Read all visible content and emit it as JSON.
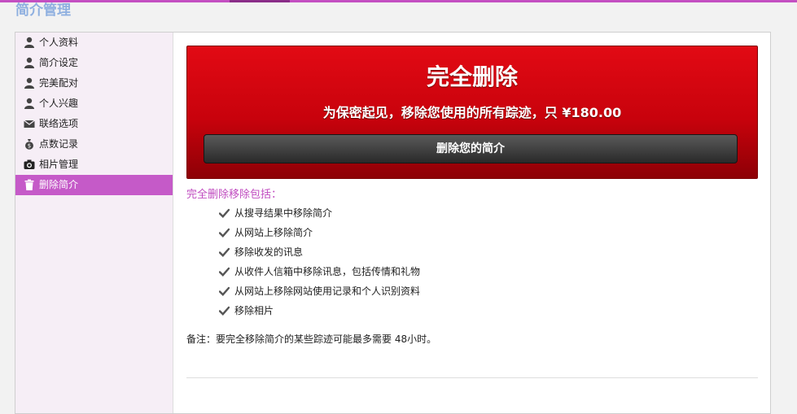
{
  "header": {
    "title": "简介管理"
  },
  "sidebar": {
    "items": [
      {
        "label": "个人资料",
        "icon": "user-icon"
      },
      {
        "label": "简介设定",
        "icon": "user-icon"
      },
      {
        "label": "完美配对",
        "icon": "user-icon"
      },
      {
        "label": "个人兴趣",
        "icon": "user-icon"
      },
      {
        "label": "联络选项",
        "icon": "envelope-icon"
      },
      {
        "label": "点数记录",
        "icon": "money-bag-icon"
      },
      {
        "label": "相片管理",
        "icon": "camera-icon"
      },
      {
        "label": "删除简介",
        "icon": "trash-icon",
        "active": true
      }
    ]
  },
  "banner": {
    "title": "完全删除",
    "subtitle": "为保密起见，移除您使用的所有踪迹，只 ¥180.00",
    "button_label": "删除您的简介"
  },
  "includes": {
    "title": "完全删除移除包括：",
    "items": [
      "从搜寻结果中移除简介",
      "从网站上移除简介",
      "移除收发的讯息",
      "从收件人信箱中移除讯息，包括传情和礼物",
      "从网站上移除网站使用记录和个人识别资料",
      "移除相片"
    ]
  },
  "note": "备注：要完全移除简介的某些踪迹可能最多需要 48小时。",
  "colors": {
    "accent": "#c55ac8",
    "banner_red": "#d4050f",
    "button_dark": "#3a3a3a"
  }
}
